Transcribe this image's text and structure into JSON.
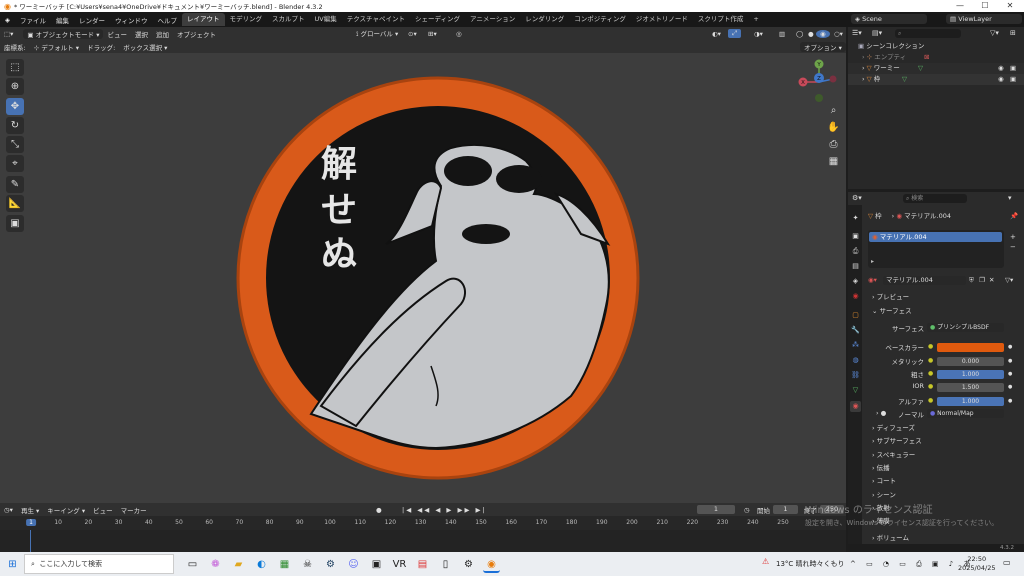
{
  "window": {
    "title": "* ワーミーバッチ [C:¥Users¥sena4¥OneDrive¥ドキュメント¥ワーミーバッチ.blend] - Blender 4.3.2",
    "min": "—",
    "max": "☐",
    "close": "✕"
  },
  "menu": [
    "ファイル",
    "編集",
    "レンダー",
    "ウィンドウ",
    "ヘルプ"
  ],
  "workspaces": [
    "レイアウト",
    "モデリング",
    "スカルプト",
    "UV編集",
    "テクスチャペイント",
    "シェーディング",
    "アニメーション",
    "レンダリング",
    "コンポジティング",
    "ジオメトリノード",
    "スクリプト作成"
  ],
  "workspace_add": "+",
  "scene": "Scene",
  "view_layer": "ViewLayer",
  "viewport_header": {
    "mode": "オブジェクトモード",
    "menus": [
      "ビュー",
      "選択",
      "追加",
      "オブジェクト"
    ],
    "transform": "グローバル",
    "options": "オプション"
  },
  "tool_header": {
    "coord_label": "座標系:",
    "coord_value": "デフォルト",
    "drag_label": "ドラッグ:",
    "drag_value": "ボックス選択"
  },
  "badge": {
    "text_lines": [
      "解",
      "せ",
      "ぬ"
    ],
    "rim_color": "#d95a1a",
    "inner_color": "#141414",
    "figure_color": "#c4c6c9"
  },
  "gizmo": {
    "x": "X",
    "y": "Y",
    "z": "Z"
  },
  "timeline": {
    "playback": "再生",
    "keying": "キーイング",
    "view": "ビュー",
    "marker": "マーカー",
    "current_frame": "1",
    "start_label": "開始",
    "start": "1",
    "end_label": "終了",
    "end": "250",
    "ticks": [
      "1",
      "10",
      "20",
      "30",
      "40",
      "50",
      "60",
      "70",
      "80",
      "90",
      "100",
      "110",
      "120",
      "130",
      "140",
      "150",
      "160",
      "170",
      "180",
      "190",
      "200",
      "210",
      "220",
      "230",
      "240",
      "250"
    ]
  },
  "outliner": {
    "search_placeholder": "",
    "collection": "シーンコレクション",
    "items": [
      "エンプティ",
      "ワーミー",
      "枠"
    ]
  },
  "properties": {
    "search_placeholder": "検索",
    "breadcrumb_object": "枠",
    "breadcrumb_material": "マテリアル.004",
    "slot": "マテリアル.004",
    "material_name": "マテリアル.004",
    "preview": "プレビュー",
    "surface_header": "サーフェス",
    "surface_label": "サーフェス",
    "surface_value": "プリンシプルBSDF",
    "fields": [
      {
        "label": "ベースカラー",
        "value": "",
        "color": "#e05a0e"
      },
      {
        "label": "メタリック",
        "value": "0.000",
        "color": "#545454"
      },
      {
        "label": "粗さ",
        "value": "1.000",
        "color": "#4a74b6"
      },
      {
        "label": "IOR",
        "value": "1.500",
        "color": "#545454"
      },
      {
        "label": "アルファ",
        "value": "1.000",
        "color": "#4a74b6"
      }
    ],
    "normal_label": "ノーマル",
    "normal_value": "Normal/Map",
    "subsections": [
      "ディフューズ",
      "サブサーフェス",
      "スペキュラー",
      "伝播",
      "コート",
      "シーン",
      "放射",
      "薄膜"
    ],
    "volume": "ボリューム",
    "version": "4.3.2"
  },
  "watermark": {
    "line1": "Windows のライセンス認証",
    "line2": "設定を開き、Windows のライセンス認証を行ってください。"
  },
  "taskbar": {
    "search_placeholder": "ここに入力して検索",
    "weather": "13°C  晴れ時々くもり",
    "time": "22:50",
    "date": "2025/04/25"
  }
}
